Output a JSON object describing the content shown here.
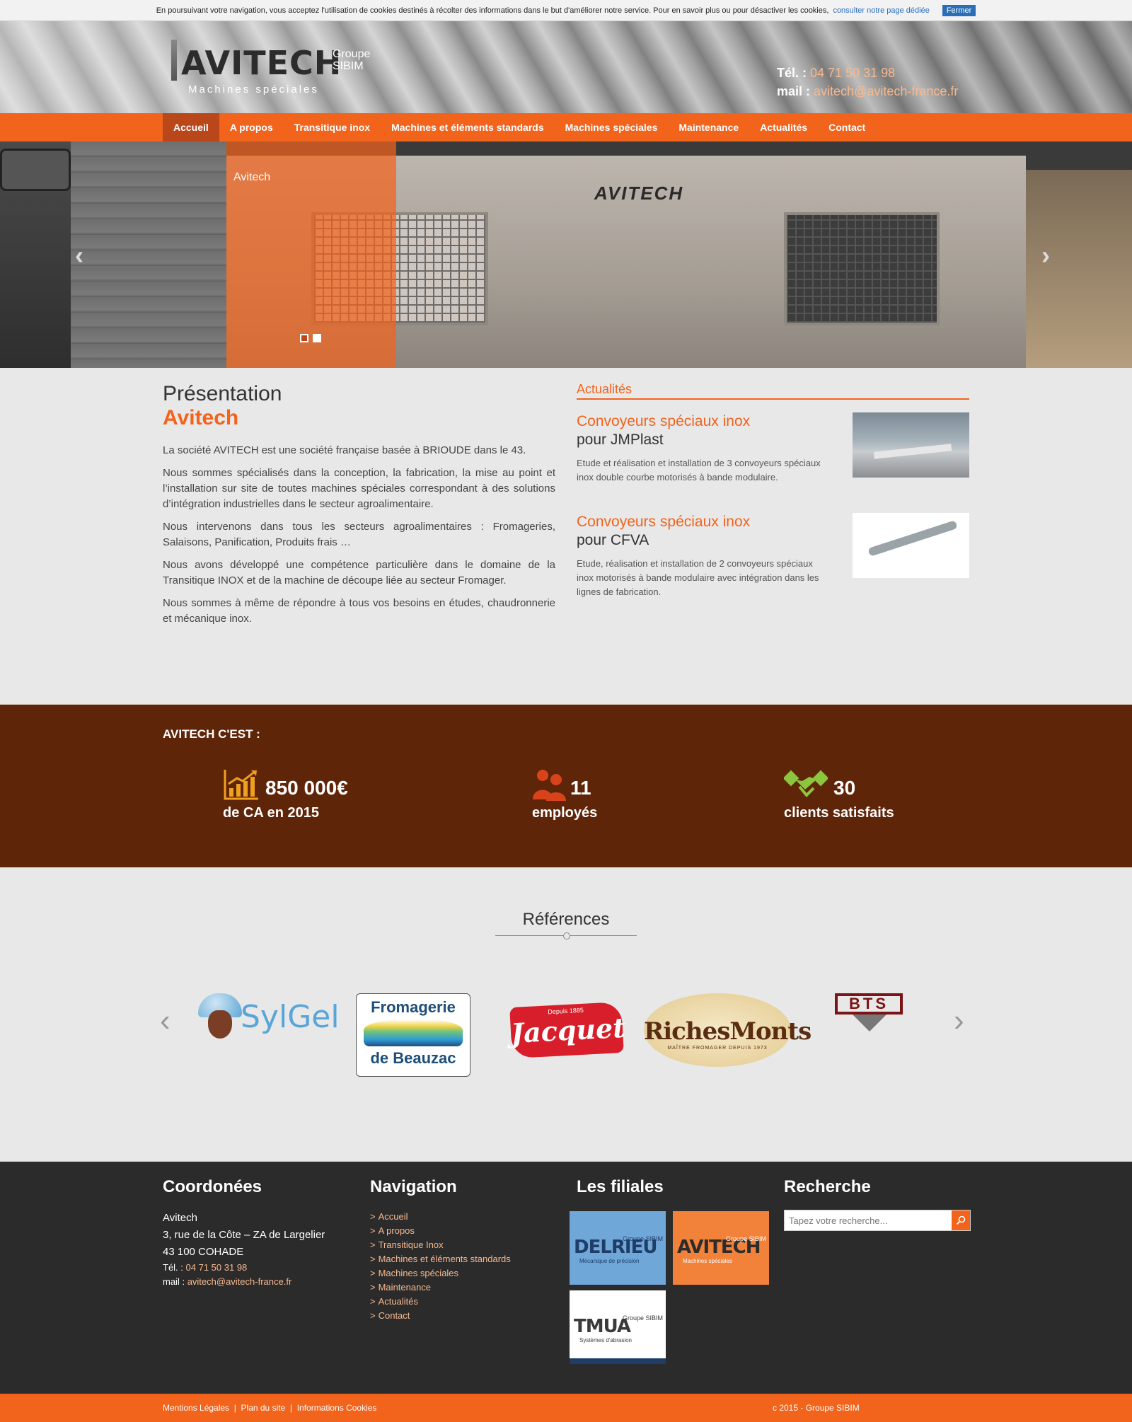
{
  "cookie": {
    "text": "En poursuivant votre navigation, vous acceptez l'utilisation de cookies destinés à récolter des informations dans le but d'améliorer notre service. Pour en savoir plus ou pour désactiver les cookies,",
    "link": "consulter notre page dédiée",
    "close": "Fermer"
  },
  "header": {
    "logo_word": "AVITECH",
    "logo_group_1": "Groupe",
    "logo_group_2": "SIBIM",
    "logo_tagline": "Machines spéciales",
    "tel_label": "Tél. :",
    "tel": "04 71 50 31 98",
    "mail_label": "mail :",
    "mail": "avitech@avitech-france.fr"
  },
  "nav": {
    "items": [
      {
        "label": "Accueil",
        "active": true
      },
      {
        "label": "A propos"
      },
      {
        "label": "Transitique inox"
      },
      {
        "label": "Machines et éléments standards"
      },
      {
        "label": "Machines spéciales"
      },
      {
        "label": "Maintenance"
      },
      {
        "label": "Actualités"
      },
      {
        "label": "Contact"
      }
    ]
  },
  "slider": {
    "caption": "Avitech",
    "machine_brand": "AVITECH",
    "prev_icon": "chevron-left-icon",
    "next_icon": "chevron-right-icon"
  },
  "presentation": {
    "title": "Présentation",
    "subtitle": "Avitech",
    "paragraphs": [
      "La société AVITECH est une société française basée à BRIOUDE dans le 43.",
      "Nous sommes spécialisés dans la conception, la fabrication, la mise au point et l’installation sur site de toutes machines spéciales correspondant à des solutions d’intégration industrielles dans le secteur agroalimentaire.",
      "Nous intervenons dans tous les secteurs agroalimentaires : Fromageries, Salaisons, Panification, Produits frais …",
      "Nous avons développé une compétence particulière dans le domaine de la Transitique INOX et de la machine de découpe liée au secteur Fromager.",
      " Nous sommes à même de répondre à tous vos besoins en études, chaudronnerie et mécanique inox."
    ]
  },
  "news": {
    "heading": "Actualités",
    "items": [
      {
        "title_1": "Convoyeurs spéciaux inox",
        "title_2": "pour JMPlast",
        "description": "Etude et réalisation et installation de 3 convoyeurs spéciaux inox double courbe motorisés à bande modulaire."
      },
      {
        "title_1": "Convoyeurs spéciaux inox",
        "title_2": "pour CFVA",
        "description": "Etude, réalisation et installation de 2 convoyeurs spéciaux inox motorisés à bande modulaire avec intégration dans les lignes de fabrication."
      }
    ]
  },
  "stats": {
    "heading": "AVITECH C'EST :",
    "items": [
      {
        "icon": "chart-growth-icon",
        "value": "850 000€",
        "label": "de CA en 2015"
      },
      {
        "icon": "people-icon",
        "value": "11",
        "label": "employés"
      },
      {
        "icon": "handshake-icon",
        "value": "30",
        "label": "clients satisfaits"
      }
    ],
    "colors": {
      "background": "#5f2509",
      "icon_orange": "#f0a020",
      "icon_red": "#d9431b",
      "icon_green": "#8cc63f"
    }
  },
  "references": {
    "title": "Références",
    "logos": [
      {
        "name": "SylGel"
      },
      {
        "line_1": "Fromagerie",
        "line_2": "de Beauzac"
      },
      {
        "small": "Depuis 1885",
        "name": "Jacquet"
      },
      {
        "name": "RichesMonts",
        "tagline": "MAÎTRE FROMAGER DEPUIS 1973"
      },
      {
        "name": "BTS"
      }
    ]
  },
  "footer": {
    "coord": {
      "title": "Coordonées",
      "name": "Avitech",
      "address_1": "3, rue de la Côte – ZA de Largelier",
      "address_2": "43 100 COHADE",
      "tel_label": "Tél. :",
      "tel": "04 71 50 31 98",
      "mail_label": "mail :",
      "mail": "avitech@avitech-france.fr"
    },
    "navigation": {
      "title": "Navigation",
      "items": [
        "Accueil",
        "A propos",
        "Transitique Inox",
        "Machines et éléments standards",
        "Machines spéciales",
        "Maintenance",
        "Actualités",
        "Contact"
      ]
    },
    "filiales": {
      "title": "Les filiales",
      "items": [
        {
          "name": "DELRIEU",
          "group": "Groupe SIBIM",
          "sub": "Mécanique de précision",
          "color": "#6fa7d9"
        },
        {
          "name": "AVITECH",
          "group": "Groupe SIBIM",
          "sub": "Machines spéciales",
          "color": "#f2813a"
        },
        {
          "name": "TMUA",
          "group": "Groupe SIBIM",
          "sub": "Systèmes d'abrasion",
          "color": "#ffffff"
        }
      ]
    },
    "search": {
      "title": "Recherche",
      "placeholder": "Tapez votre recherche..."
    }
  },
  "bottom": {
    "links": [
      "Mentions Légales",
      "Plan du site",
      "Informations Cookies"
    ],
    "copyright": "c 2015 - Groupe SIBIM"
  },
  "colors": {
    "accent": "#f2631c",
    "nav_active": "#b9471a",
    "footer": "#2b2b2b"
  }
}
